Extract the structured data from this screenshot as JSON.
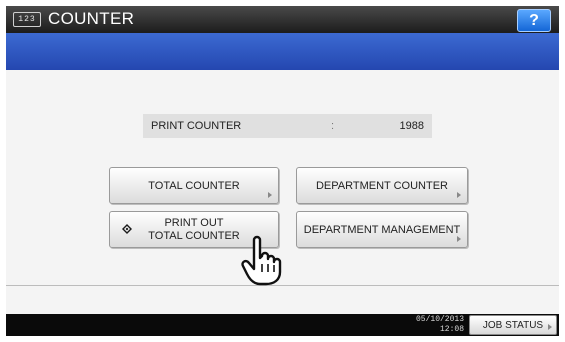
{
  "title_bar": {
    "icon_text": "123",
    "title": "COUNTER",
    "help_label": "?"
  },
  "counter": {
    "label": "PRINT COUNTER",
    "separator": ":",
    "value": "1988"
  },
  "buttons": {
    "total_counter": "TOTAL COUNTER",
    "department_counter": "DEPARTMENT COUNTER",
    "print_out_line1": "PRINT OUT",
    "print_out_line2": "TOTAL COUNTER",
    "department_management": "DEPARTMENT MANAGEMENT"
  },
  "status_bar": {
    "date": "05/10/2013",
    "time": "12:08",
    "job_status": "JOB STATUS"
  },
  "icons": {
    "counter_app": "counter-app-icon",
    "print_diamond": "diamond-icon",
    "pointer": "hand-pointer-icon"
  },
  "colors": {
    "title_bar": "#1c1c1c",
    "blue_band": "#2f57c0",
    "help_button": "#1f78e6"
  }
}
